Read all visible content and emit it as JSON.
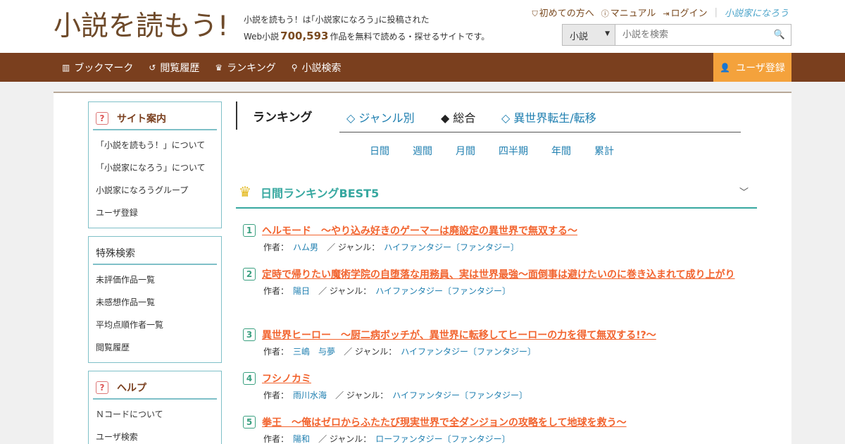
{
  "header": {
    "logo": "小説を読もう!",
    "desc_line1": "小説を読もう！は｢小説家になろう｣に投稿された",
    "desc_line2_pre": "Web小説",
    "count": "700,593",
    "desc_line2_post": "作品を無料で読める・探せるサイトです。",
    "links": [
      "初めての方へ",
      "マニュアル",
      "ログイン"
    ],
    "narou_logo": "小説家になろう",
    "search": {
      "select": "小説",
      "placeholder": "小説を検索"
    }
  },
  "nav": {
    "items": [
      "ブックマーク",
      "閲覧履歴",
      "ランキング",
      "小説検索"
    ],
    "register": "ユーザ登録"
  },
  "sidebar": {
    "guide": {
      "title": "サイト案内",
      "items": [
        "「小説を読もう！」について",
        "「小説家になろう」について",
        "小説家になろうグループ",
        "ユーザ登録"
      ]
    },
    "special": {
      "title": "特殊検索",
      "items": [
        "未評価作品一覧",
        "未感想作品一覧",
        "平均点順作者一覧",
        "閲覧履歴"
      ]
    },
    "help": {
      "title": "ヘルプ",
      "items": [
        "Ｎコードについて",
        "ユーザ検索"
      ]
    }
  },
  "ranking": {
    "title": "ランキング",
    "tabs": [
      "◇ ジャンル別",
      "◆ 総合",
      "◇ 異世界転生/転移"
    ],
    "periods": [
      "日間",
      "週間",
      "月間",
      "四半期",
      "年間",
      "累計"
    ],
    "best_title": "日間ランキングBEST5",
    "author_label": "作者：",
    "genre_label": "／ ジャンル：",
    "entries": [
      {
        "rank": "1",
        "title": "ヘルモード　～やり込み好きのゲーマーは廃設定の異世界で無双する～",
        "author": "ハム男",
        "genre": "ハイファンタジー〔ファンタジー〕"
      },
      {
        "rank": "2",
        "title": "定時で帰りたい魔術学院の自堕落な用務員、実は世界最強～面倒事は避けたいのに巻き込まれて成り上がり",
        "author": "陽日",
        "genre": "ハイファンタジー〔ファンタジー〕"
      },
      {
        "rank": "3",
        "title": "異世界ヒーロー　～厨二病ボッチが、異世界に転移してヒーローの力を得て無双する!?～",
        "author": "三嶋　与夢",
        "genre": "ハイファンタジー〔ファンタジー〕"
      },
      {
        "rank": "4",
        "title": "フシノカミ",
        "author": "雨川水海",
        "genre": "ハイファンタジー〔ファンタジー〕"
      },
      {
        "rank": "5",
        "title": "拳王　～俺はゼロからふたたび現実世界で全ダンジョンの攻略をして地球を救う～",
        "author": "陽和",
        "genre": "ローファンタジー〔ファンタジー〕"
      }
    ]
  }
}
